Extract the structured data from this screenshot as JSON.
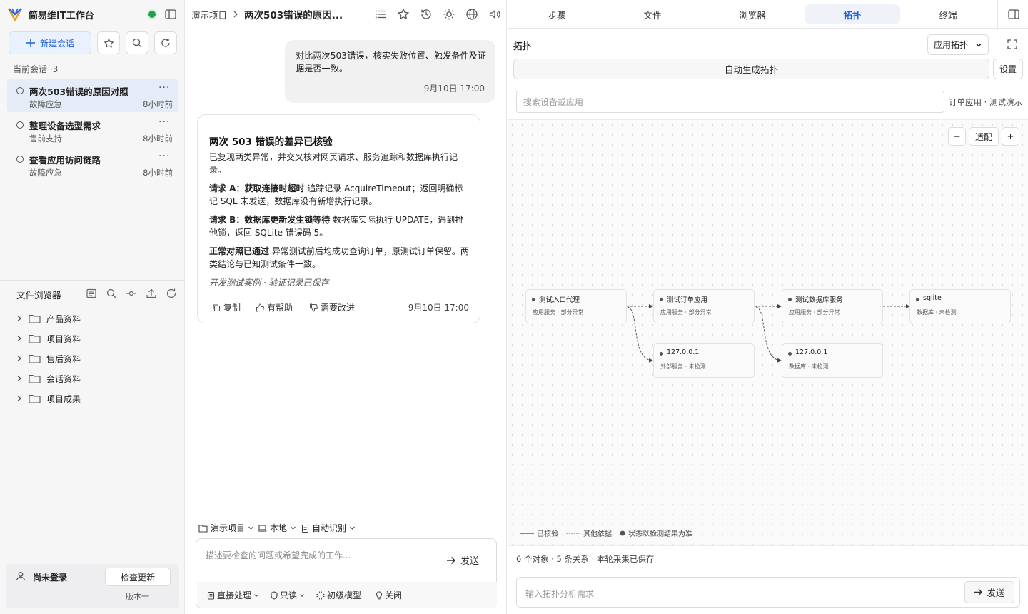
{
  "app": {
    "title": "简易维IT工作台"
  },
  "sidebar": {
    "new_session_label": "新建会话",
    "sessions_header": "当前会话 ·3",
    "sessions": [
      {
        "title": "两次503错误的原因对照",
        "tag": "故障应急",
        "time": "8小时前",
        "more": "···"
      },
      {
        "title": "整理设备选型需求",
        "tag": "售前支持",
        "time": "8小时前",
        "more": "···"
      },
      {
        "title": "查看应用访问链路",
        "tag": "故障应急",
        "time": "8小时前",
        "more": "···"
      }
    ],
    "file_browser_title": "文件浏览器",
    "folders": [
      "产品资料",
      "项目资料",
      "售后资料",
      "会话资料",
      "项目成果"
    ],
    "account": {
      "name": "尚未登录",
      "check_update": "检查更新",
      "version": "版本一"
    }
  },
  "chat": {
    "breadcrumb_root": "演示项目",
    "breadcrumb_current": "两次503错误的原因...",
    "user_message": {
      "text": "对比两次503错误，核实失败位置、触发条件及证据是否一致。",
      "time": "9月10日 17:00"
    },
    "reply": {
      "title": "两次 503 错误的差异已核验",
      "intro": "已复现两类异常，并交叉核对网页请求、服务追踪和数据库执行记录。",
      "items": [
        {
          "label": "请求 A：获取连接时超时",
          "text": " 追踪记录 AcquireTimeout；返回明确标记 SQL 未发送，数据库没有新增执行记录。"
        },
        {
          "label": "请求 B：数据库更新发生锁等待",
          "text": " 数据库实际执行 UPDATE，遇到排他锁，返回 SQLite 错误码 5。"
        },
        {
          "label": "正常对照已通过",
          "text": " 异常测试前后均成功查询订单，原测试订单保留。两类结论与已知测试条件一致。"
        }
      ],
      "note": "开发测试案例 · 验证记录已保存",
      "copy": "复制",
      "helpful": "有帮助",
      "improve": "需要改进",
      "time": "9月10日 17:00"
    },
    "context": {
      "project": "演示项目",
      "env": "本地",
      "detect": "自动识别"
    },
    "composer": {
      "placeholder": "描述要检查的问题或希望完成的工作...",
      "send": "发送",
      "mode": "直接处理",
      "perm": "只读",
      "model": "初级模型",
      "close": "关闭"
    }
  },
  "right": {
    "tabs": [
      "步骤",
      "文件",
      "浏览器",
      "拓扑",
      "终端"
    ],
    "active_tab": "拓扑",
    "title": "拓扑",
    "view_select": "应用拓扑",
    "auto_generate": "自动生成拓扑",
    "settings": "设置",
    "search_placeholder": "搜索设备或应用",
    "scope": "订单应用 · 测试演示",
    "zoom": {
      "minus": "−",
      "fit": "适配",
      "plus": "+"
    },
    "nodes": [
      {
        "name": "测试入口代理",
        "status": "应用服务 · 部分异常"
      },
      {
        "name": "测试订单应用",
        "status": "应用服务 · 部分异常"
      },
      {
        "name": "测试数据库服务",
        "status": "应用服务 · 部分异常"
      },
      {
        "name": "sqlite",
        "status": "数据库 · 未检测"
      },
      {
        "name": "127.0.0.1",
        "status": "外部服务 · 未检测"
      },
      {
        "name": "127.0.0.1",
        "status": "数据库 · 未检测"
      }
    ],
    "legend": {
      "verified": "已核验",
      "other": "其他依据",
      "status": "状态以检测结果为准"
    },
    "stats": "6 个对象 · 5 条关系 · 本轮采集已保存",
    "input_placeholder": "输入拓扑分析需求",
    "send": "发送"
  }
}
